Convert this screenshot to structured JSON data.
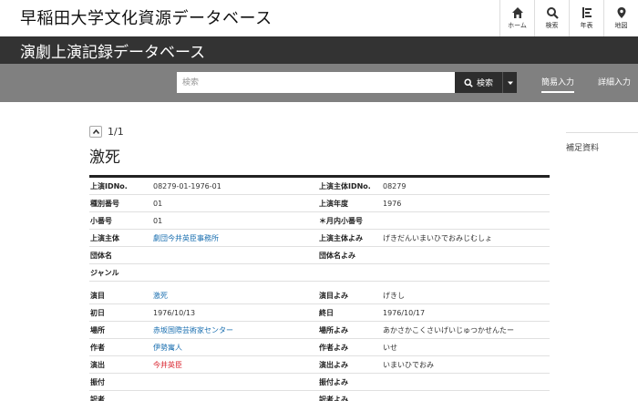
{
  "header": {
    "site_title": "早稲田大学文化資源データベース",
    "nav": [
      {
        "label": "ホーム",
        "icon": "home-icon"
      },
      {
        "label": "検索",
        "icon": "search-icon"
      },
      {
        "label": "年表",
        "icon": "timeline-icon"
      },
      {
        "label": "地図",
        "icon": "map-pin-icon"
      }
    ]
  },
  "db_title": "演劇上演記録データベース",
  "search": {
    "placeholder": "検索",
    "button_label": "検索",
    "mode_simple": "簡易入力",
    "mode_detail": "詳細入力"
  },
  "pager": {
    "text": "1/1"
  },
  "record": {
    "title": "激死",
    "rows": [
      {
        "l1": "上演IDNo.",
        "v1": "08279-01-1976-01",
        "l2": "上演主体IDNo.",
        "v2": "08279"
      },
      {
        "l1": "種別番号",
        "v1": "01",
        "l2": "上演年度",
        "v2": "1976"
      },
      {
        "l1": "小番号",
        "v1": "01",
        "l2": "＊月内小番号",
        "v2": ""
      },
      {
        "l1": "上演主体",
        "v1": "劇団今井英臣事務所",
        "l2": "上演主体よみ",
        "v2": "げきだんいまいひでおみじむしょ"
      },
      {
        "l1": "団体名",
        "v1": "",
        "l2": "団体名よみ",
        "v2": ""
      },
      {
        "l1": "ジャンル",
        "v1": "",
        "l2": "",
        "v2": ""
      },
      {
        "l1": "演目",
        "v1": "激死",
        "l2": "演目よみ",
        "v2": "げきし"
      },
      {
        "l1": "初日",
        "v1": "1976/10/13",
        "l2": "終日",
        "v2": "1976/10/17"
      },
      {
        "l1": "場所",
        "v1": "赤坂国際芸術家センター",
        "l2": "場所よみ",
        "v2": "あかさかこくさいげいじゅつかせんたー"
      },
      {
        "l1": "作者",
        "v1": "伊勢寓人",
        "l2": "作者よみ",
        "v2": "いせ"
      },
      {
        "l1": "演出",
        "v1": "今井英臣",
        "l2": "演出よみ",
        "v2": "いまいひでおみ"
      },
      {
        "l1": "振付",
        "v1": "",
        "l2": "振付よみ",
        "v2": ""
      },
      {
        "l1": "訳者",
        "v1": "",
        "l2": "訳者よみ",
        "v2": ""
      }
    ]
  },
  "sidebar": {
    "title": "補足資料"
  },
  "colors": {
    "dark_bar": "#333333",
    "search_bar": "#808080",
    "link": "#1a6fb0",
    "red_link": "#d9232e"
  }
}
